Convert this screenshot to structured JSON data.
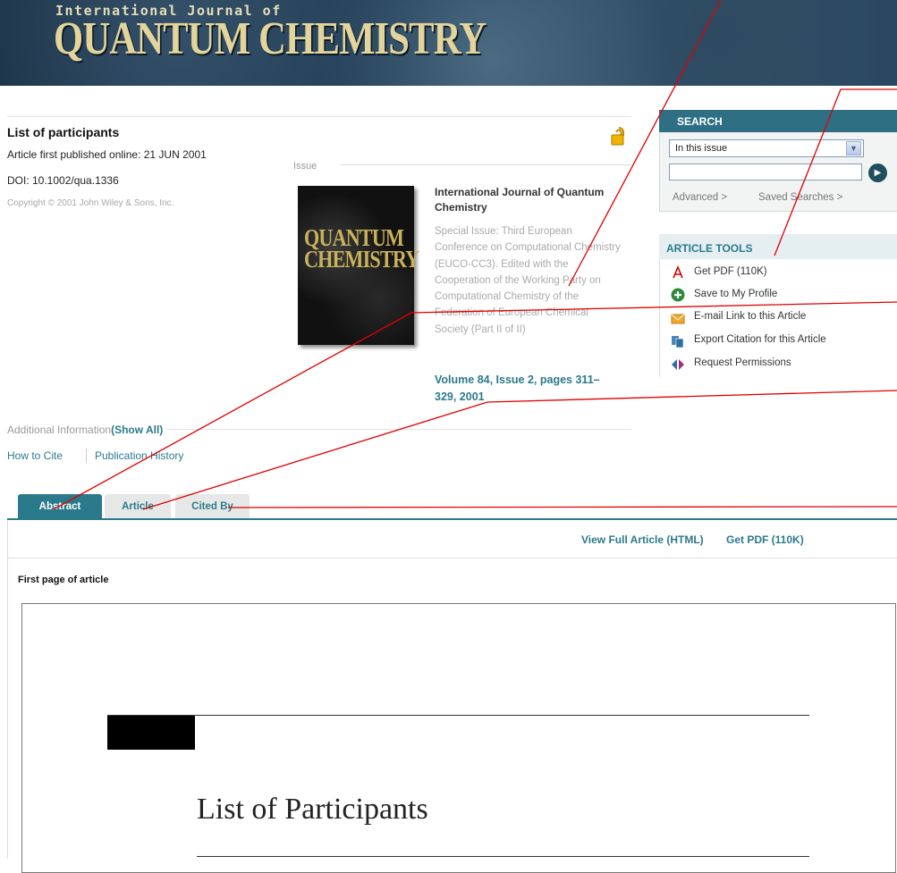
{
  "banner": {
    "top_text": "International Journal of",
    "title": "QUANTUM CHEMISTRY"
  },
  "article": {
    "title": "List of participants",
    "published": "Article first published online: 21 JUN 2001",
    "doi": "DOI: 10.1002/qua.1336",
    "copyright": "Copyright © 2001 John Wiley & Sons, Inc."
  },
  "issue": {
    "label": "Issue",
    "cover_title": "QUANTUM CHEMISTRY",
    "journal_name": "International Journal of Quantum Chemistry",
    "special_issue": "Special Issue: Third European Conference on Computational Chemistry (EUCO-CC3). Edited with the Cooperation of the Working Party on Computational Chemistry of the Federation of European Chemical Society (Part II of II)",
    "volume_link": "Volume 84, Issue 2, pages 311–329, 2001"
  },
  "additional": {
    "label": "Additional Information",
    "show_all": "(Show All)",
    "how_to_cite": "How to Cite",
    "publication_history": "Publication History"
  },
  "search": {
    "heading": "SEARCH",
    "scope": "In this issue",
    "advanced": "Advanced >",
    "saved": "Saved Searches >"
  },
  "tools": {
    "heading": "ARTICLE TOOLS",
    "items": [
      {
        "label": "Get PDF (110K)",
        "icon": "pdf-icon"
      },
      {
        "label": "Save to My Profile",
        "icon": "plus-icon"
      },
      {
        "label": "E-mail Link to this Article",
        "icon": "email-icon"
      },
      {
        "label": "Export Citation for this Article",
        "icon": "export-icon"
      },
      {
        "label": "Request Permissions",
        "icon": "permissions-icon"
      }
    ]
  },
  "tabs": {
    "abstract": "Abstract",
    "article": "Article",
    "cited_by": "Cited By"
  },
  "content_toolbar": {
    "view_full": "View Full Article (HTML)",
    "get_pdf": "Get PDF (110K)"
  },
  "first_page": {
    "label": "First page of article",
    "preview_title": "List of Participants"
  },
  "colors": {
    "accent": "#2b7a8c",
    "annotation": "#e00000"
  }
}
